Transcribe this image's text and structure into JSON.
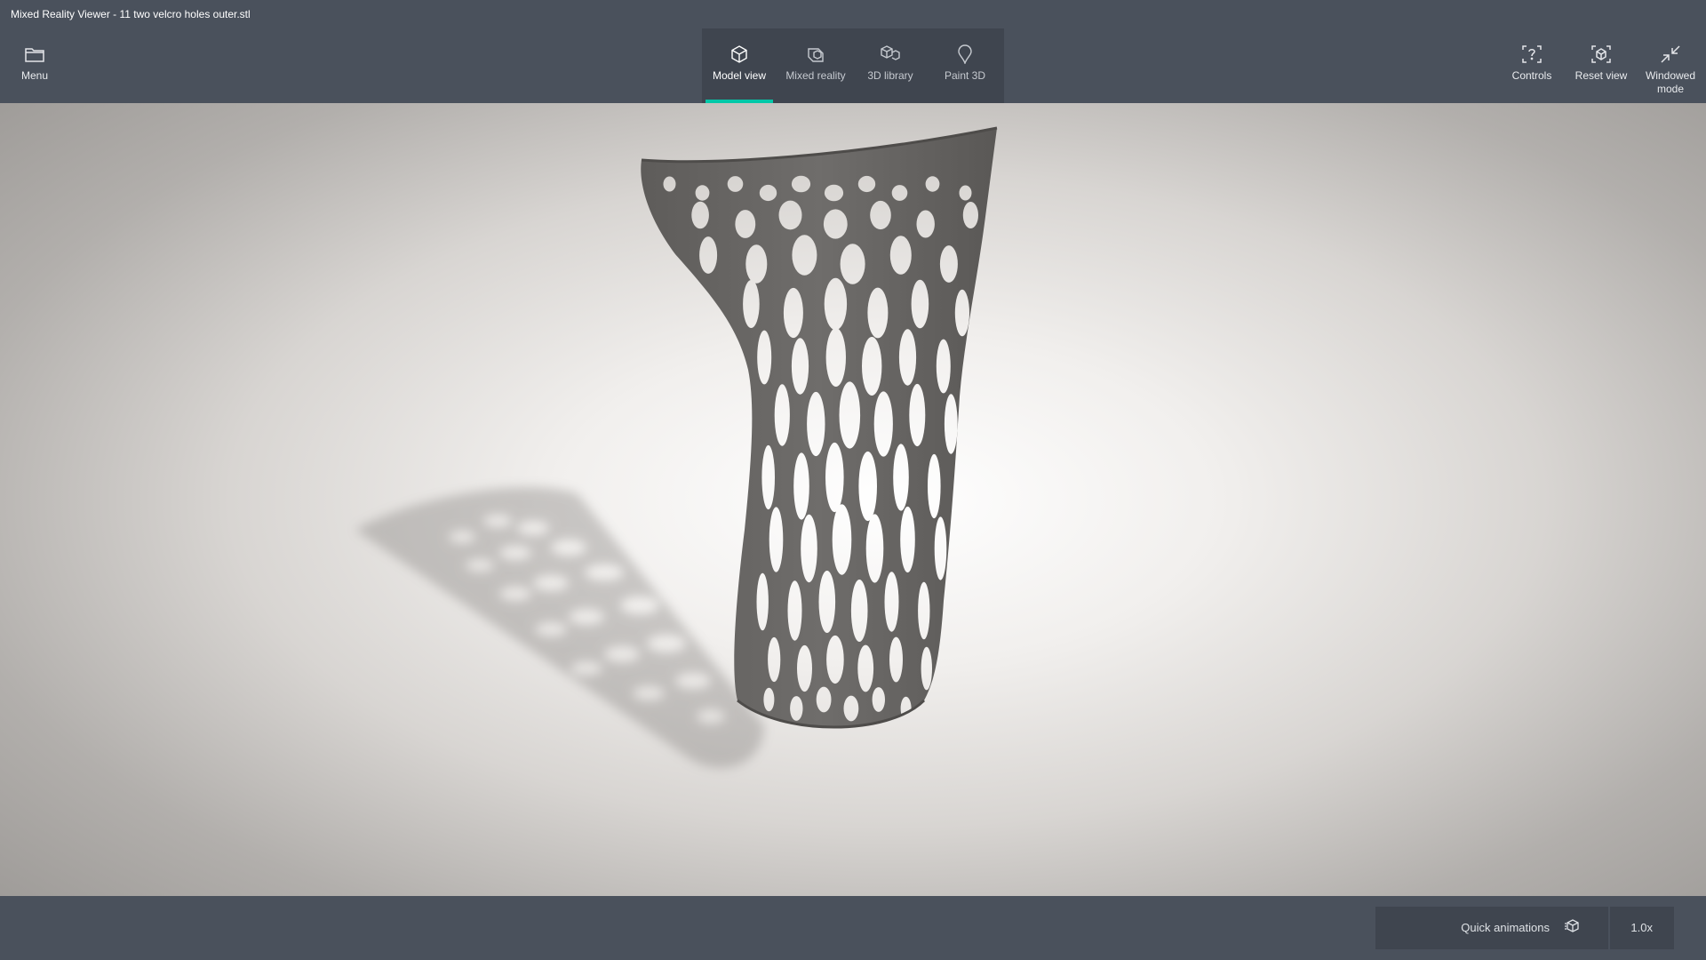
{
  "window": {
    "title": "Mixed Reality Viewer - 11 two velcro holes outer.stl"
  },
  "toolbar": {
    "menu": {
      "label": "Menu",
      "icon": "folder-icon"
    },
    "tabs": [
      {
        "label": "Model view",
        "icon": "cube-icon",
        "active": true
      },
      {
        "label": "Mixed reality",
        "icon": "mixed-reality-icon",
        "active": false
      },
      {
        "label": "3D library",
        "icon": "library-icon",
        "active": false
      },
      {
        "label": "Paint 3D",
        "icon": "paint-3d-icon",
        "active": false
      }
    ],
    "controls": {
      "label": "Controls",
      "icon": "controls-icon"
    },
    "reset_view": {
      "label": "Reset view",
      "icon": "reset-view-icon"
    },
    "windowed_mode": {
      "label_line1": "Windowed",
      "label_line2": "mode",
      "icon": "windowed-mode-icon"
    }
  },
  "footer": {
    "quick_animations_label": "Quick animations",
    "speed": "1.0x"
  },
  "colors": {
    "accent": "#00c8a8",
    "chrome": "#4a515c",
    "panel": "#3f454f",
    "model": "#6a6866"
  }
}
